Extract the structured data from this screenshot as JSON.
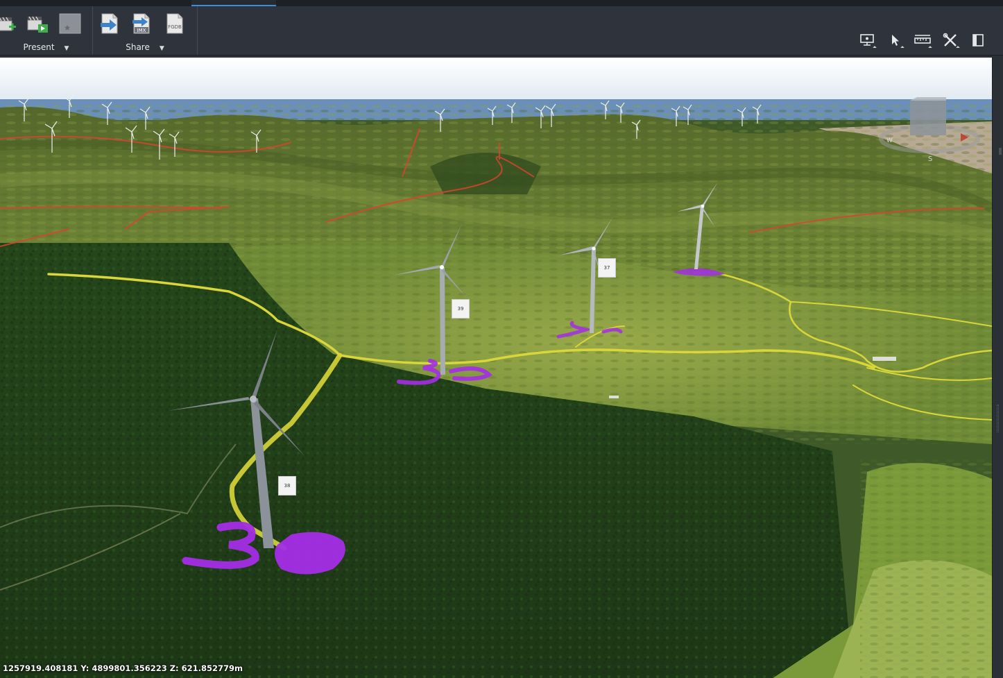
{
  "ribbon": {
    "groups": [
      {
        "id": "present",
        "label": "Present"
      },
      {
        "id": "share",
        "label": "Share"
      }
    ],
    "present_buttons": [
      "add-slide-icon",
      "play-presentation-icon",
      "bookmark-star-icon"
    ],
    "share_buttons": [
      "export-icon",
      "export-imx-icon",
      "export-fgdb-icon"
    ],
    "share_icon_text": {
      "imx": "IMX",
      "fgdb": "FGDB"
    },
    "nav_tools": [
      "screen-navigation-icon",
      "select-cursor-icon",
      "measure-icon",
      "tools-icon",
      "panel-toggle-icon"
    ]
  },
  "map": {
    "turbine_labels": [
      {
        "id": "38",
        "text": "38"
      },
      {
        "id": "39",
        "text": "39"
      },
      {
        "id": "37",
        "text": "37"
      }
    ],
    "compass": {
      "west": "W",
      "south": "S"
    },
    "colors": {
      "road": "#d9d63a",
      "boundary": "#d8442e",
      "turbine_number": "#a52de6",
      "forest": "#1f3a17",
      "pasture": "#6f8c35",
      "sky": "#e8eff5",
      "sea": "#5f87b4"
    }
  },
  "status": {
    "coordinates": "1257919.408181 Y: 4899801.356223 Z: 621.852779m"
  }
}
